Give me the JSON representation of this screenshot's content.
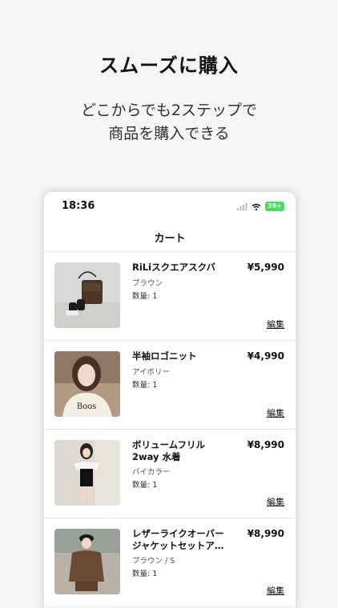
{
  "promo": {
    "headline": "スムーズに購入",
    "subline": "どこからでも2ステップで\n商品を購入できる"
  },
  "status_bar": {
    "time": "18:36",
    "battery": "39+"
  },
  "nav": {
    "title": "カート"
  },
  "cart": {
    "items": [
      {
        "name": "RiLiスクエアスクバ",
        "variant": "ブラウン",
        "quantity": "数量: 1",
        "price": "¥5,990",
        "edit": "編集",
        "thumb": "bag"
      },
      {
        "name": "半袖ロゴニット",
        "variant": "アイボリー",
        "quantity": "数量: 1",
        "price": "¥4,990",
        "edit": "編集",
        "thumb": "knit"
      },
      {
        "name": "ボリュームフリル\n2way 水着",
        "variant": "バイカラー",
        "quantity": "数量: 1",
        "price": "¥8,990",
        "edit": "編集",
        "thumb": "swimsuit"
      },
      {
        "name": "レザーライクオーバー\nジャケットセットア…",
        "variant": "ブラウン / S",
        "quantity": "数量: 1",
        "price": "¥8,990",
        "edit": "編集",
        "thumb": "jacket"
      }
    ]
  }
}
